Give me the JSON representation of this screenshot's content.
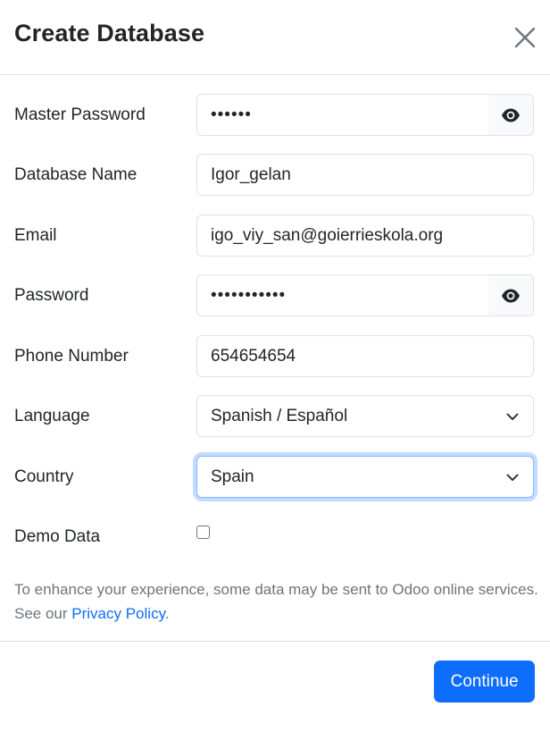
{
  "modal": {
    "title": "Create Database",
    "close_icon": "close-icon"
  },
  "form": {
    "master_password": {
      "label": "Master Password",
      "value": "••••••",
      "addon_icon": "eye-icon"
    },
    "database_name": {
      "label": "Database Name",
      "value": "Igor_gelan"
    },
    "email": {
      "label": "Email",
      "value": "igo_viy_san@goierrieskola.org"
    },
    "password": {
      "label": "Password",
      "value": "•••••••••••",
      "addon_icon": "eye-icon"
    },
    "phone": {
      "label": "Phone Number",
      "value": "654654654"
    },
    "language": {
      "label": "Language",
      "selected": "Spanish / Español"
    },
    "country": {
      "label": "Country",
      "selected": "Spain"
    },
    "demo_data": {
      "label": "Demo Data",
      "checked": false
    }
  },
  "notice": {
    "text": "To enhance your experience, some data may be sent to Odoo online services. See our ",
    "link": "Privacy Policy",
    "suffix": "."
  },
  "footer": {
    "continue_label": "Continue"
  },
  "colors": {
    "primary": "#0d6efd",
    "border": "#dee2e6",
    "muted_text": "#6c757d",
    "focus_ring": "#86b7fe"
  }
}
